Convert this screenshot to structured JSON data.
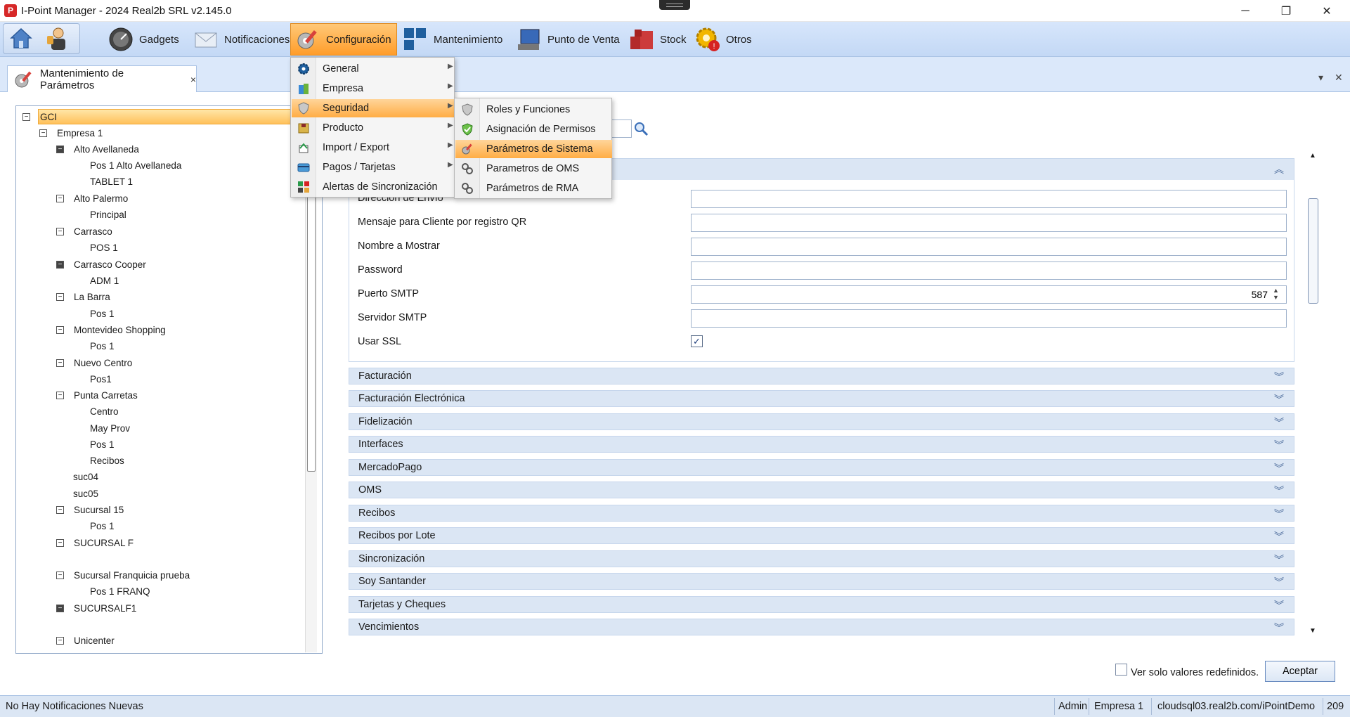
{
  "window": {
    "title": "I-Point Manager - 2024 Real2b SRL v2.145.0",
    "logo_letter": "P",
    "minimize": "─",
    "maximize": "❐",
    "close": "✕"
  },
  "toolbar": {
    "items": [
      {
        "label": "Gadgets",
        "icon": "speedometer-icon"
      },
      {
        "label": "Notificaciones",
        "icon": "envelope-icon"
      },
      {
        "label": "Configuración",
        "icon": "wrench-gear-icon"
      },
      {
        "label": "Mantenimiento",
        "icon": "blocks-icon"
      },
      {
        "label": "Punto de Venta",
        "icon": "monitor-icon"
      },
      {
        "label": "Stock",
        "icon": "boxes-icon"
      },
      {
        "label": "Otros",
        "icon": "gear-alert-icon"
      }
    ]
  },
  "tab": {
    "label": "Mantenimiento de Parámetros",
    "close": "×"
  },
  "tree": {
    "items": [
      {
        "label": "GCI"
      },
      {
        "label": "Empresa 1"
      },
      {
        "label": "Alto Avellaneda"
      },
      {
        "label": "Pos 1 Alto Avellaneda"
      },
      {
        "label": "TABLET 1"
      },
      {
        "label": "Alto Palermo"
      },
      {
        "label": "Principal"
      },
      {
        "label": "Carrasco"
      },
      {
        "label": "POS 1"
      },
      {
        "label": "Carrasco Cooper"
      },
      {
        "label": "ADM 1"
      },
      {
        "label": "La Barra"
      },
      {
        "label": "Pos 1"
      },
      {
        "label": "Montevideo Shopping"
      },
      {
        "label": "Pos 1"
      },
      {
        "label": "Nuevo Centro"
      },
      {
        "label": "Pos1"
      },
      {
        "label": "Punta Carretas"
      },
      {
        "label": "Centro"
      },
      {
        "label": "May Prov"
      },
      {
        "label": "Pos 1"
      },
      {
        "label": "Recibos"
      },
      {
        "label": "suc04"
      },
      {
        "label": "suc05"
      },
      {
        "label": "Sucursal 15"
      },
      {
        "label": "Pos 1"
      },
      {
        "label": "SUCURSAL F"
      },
      {
        "label": "Sucursal Franquicia prueba"
      },
      {
        "label": "Pos 1 FRANQ"
      },
      {
        "label": "SUCURSALF1"
      },
      {
        "label": "Unicenter"
      }
    ]
  },
  "params": {
    "rows": [
      {
        "label": "Dirección de Envío",
        "value": ""
      },
      {
        "label": "Mensaje para Cliente por registro QR",
        "value": ""
      },
      {
        "label": "Nombre a Mostrar",
        "value": ""
      },
      {
        "label": "Password",
        "value": ""
      },
      {
        "label": "Puerto SMTP",
        "value": "587"
      },
      {
        "label": "Servidor SMTP",
        "value": ""
      }
    ],
    "ssl_label": "Usar SSL",
    "ssl_checked": "✓",
    "collapse_glyph": "︽",
    "expand_glyph": "︾",
    "sections": [
      "Facturación",
      "Facturación Electrónica",
      "Fidelización",
      "Interfaces",
      "MercadoPago",
      "OMS",
      "Recibos",
      "Recibos por Lote",
      "Sincronización",
      "Soy Santander",
      "Tarjetas y Cheques",
      "Vencimientos"
    ]
  },
  "footer": {
    "redefined_label": "Ver solo valores redefinidos.",
    "accept_label": "Aceptar"
  },
  "status": {
    "notifications": "No Hay Notificaciones Nuevas",
    "user": "Admin",
    "company": "Empresa 1",
    "server": "cloudsql03.real2b.com/iPointDemo",
    "code": "209"
  },
  "config_menu": {
    "items": [
      {
        "label": "General",
        "icon": "gear-icon",
        "submenu": true
      },
      {
        "label": "Empresa",
        "icon": "building-icon",
        "submenu": true
      },
      {
        "label": "Seguridad",
        "icon": "shield-icon",
        "submenu": true
      },
      {
        "label": "Producto",
        "icon": "product-box-icon",
        "submenu": true
      },
      {
        "label": "Import / Export",
        "icon": "import-export-icon",
        "submenu": true
      },
      {
        "label": "Pagos / Tarjetas",
        "icon": "card-icon",
        "submenu": true
      },
      {
        "label": "Alertas de Sincronización",
        "icon": "sync-alert-icon",
        "submenu": false
      }
    ],
    "arrow": "▶"
  },
  "security_menu": {
    "items": [
      {
        "label": "Roles y Funciones",
        "icon": "shield-gray-icon"
      },
      {
        "label": "Asignación de Permisos",
        "icon": "shield-green-icon"
      },
      {
        "label": "Parámetros de Sistema",
        "icon": "wrench-icon"
      },
      {
        "label": "Parametros de OMS",
        "icon": "gears-icon"
      },
      {
        "label": "Parámetros de RMA",
        "icon": "gears-icon"
      }
    ]
  },
  "colors": {
    "accent_orange": "#ffad45",
    "toolbar_blue": "#c3d8f5",
    "section_blue": "#dbe6f4"
  }
}
